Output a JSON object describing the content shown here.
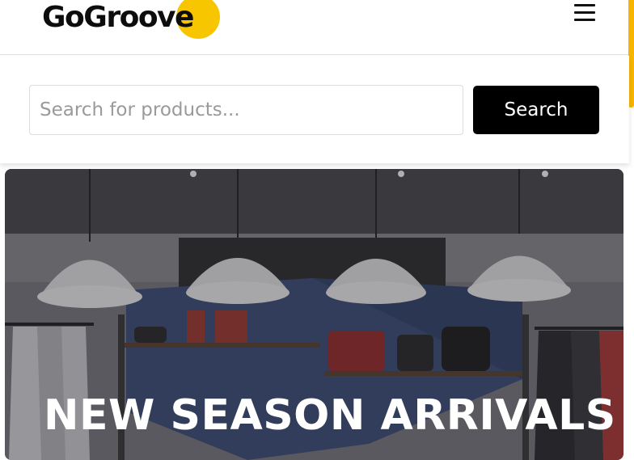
{
  "header": {
    "logo_text": "GoGroove",
    "brand_color": "#f7c600",
    "menu_icon": "hamburger-menu-icon"
  },
  "search": {
    "placeholder": "Search for products...",
    "value": "",
    "button_label": "Search"
  },
  "hero": {
    "title": "NEW SEASON ARRIVALS"
  }
}
